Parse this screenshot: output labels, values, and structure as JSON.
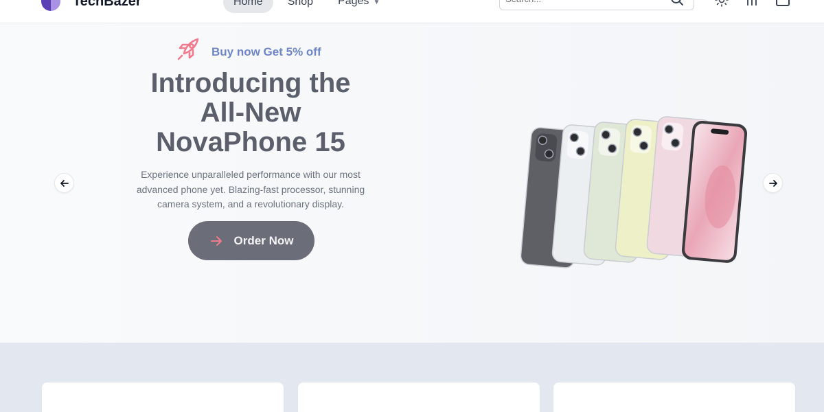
{
  "brand": {
    "name": "TechBazer",
    "colors": {
      "primary": "#5b3fb5",
      "accent": "#6e86c8",
      "rocket": "#f07b8e"
    }
  },
  "nav": {
    "links": [
      {
        "label": "Home",
        "active": true
      },
      {
        "label": "Shop",
        "active": false
      },
      {
        "label": "Pages",
        "active": false,
        "has_dropdown": true
      }
    ],
    "search": {
      "placeholder": "Search..."
    },
    "icons": [
      "search-icon",
      "theme-toggle-icon",
      "compare-icon",
      "cart-icon"
    ]
  },
  "hero": {
    "promo": "Buy now Get 5% off",
    "title_lines": [
      "Introducing the",
      "All-New",
      "NovaPhone 15"
    ],
    "description": "Experience unparalleled performance with our most advanced phone yet. Blazing-fast processor, stunning camera system, and a revolutionary display.",
    "cta_label": "Order Now",
    "phone_colors": [
      "#5f6066",
      "#eceff1",
      "#dfe8d6",
      "#eef0c8",
      "#f1d9e1",
      "#f4dce3"
    ]
  },
  "categories": {
    "card_count": 3
  }
}
